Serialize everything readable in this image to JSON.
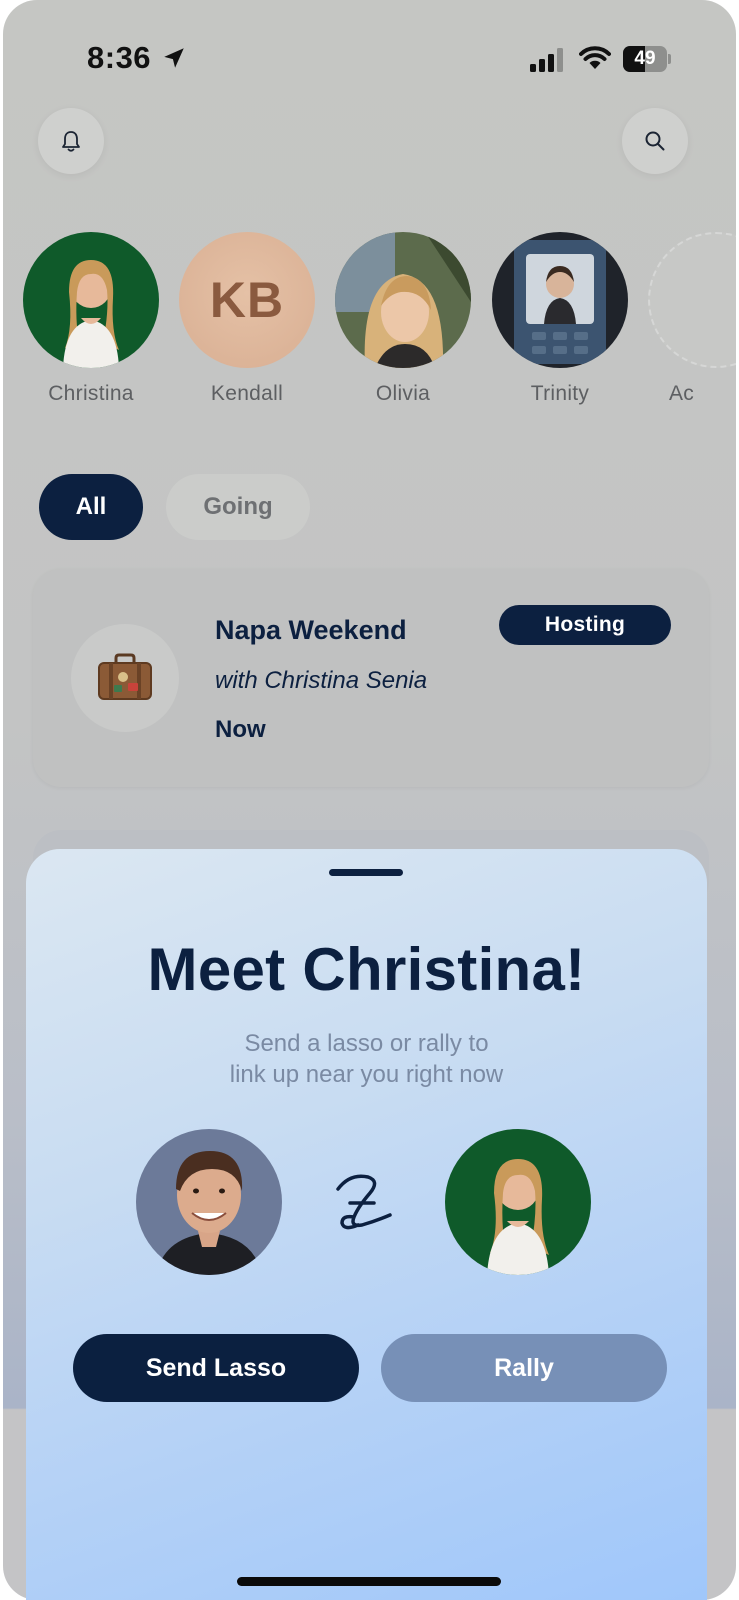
{
  "status_bar": {
    "time": "8:36",
    "battery_percent": 49,
    "battery_label": "49"
  },
  "header": {
    "left_icon": "bell-icon",
    "right_icon": "search-icon"
  },
  "stories": [
    {
      "name": "Christina",
      "avatar": "photo"
    },
    {
      "name": "Kendall",
      "avatar": "initials",
      "initials": "KB"
    },
    {
      "name": "Olivia",
      "avatar": "photo"
    },
    {
      "name": "Trinity",
      "avatar": "photo"
    },
    {
      "name": "Ac",
      "avatar": "add-placeholder"
    }
  ],
  "filters": {
    "all": "All",
    "going": "Going",
    "selected": "All"
  },
  "event": {
    "icon": "suitcase-icon",
    "title": "Napa Weekend",
    "with": "with Christina Senia",
    "time": "Now",
    "badge": "Hosting"
  },
  "sheet": {
    "title": "Meet Christina!",
    "subtitle_line1": "Send a lasso or rally to",
    "subtitle_line2": "link up near you right now",
    "center_icon": "lasso-logo-icon",
    "primary_button": "Send Lasso",
    "secondary_button": "Rally"
  },
  "colors": {
    "navy": "#0c2040",
    "rally": "#7790b7",
    "sheet_gradient_end": "#9ec6fb"
  }
}
